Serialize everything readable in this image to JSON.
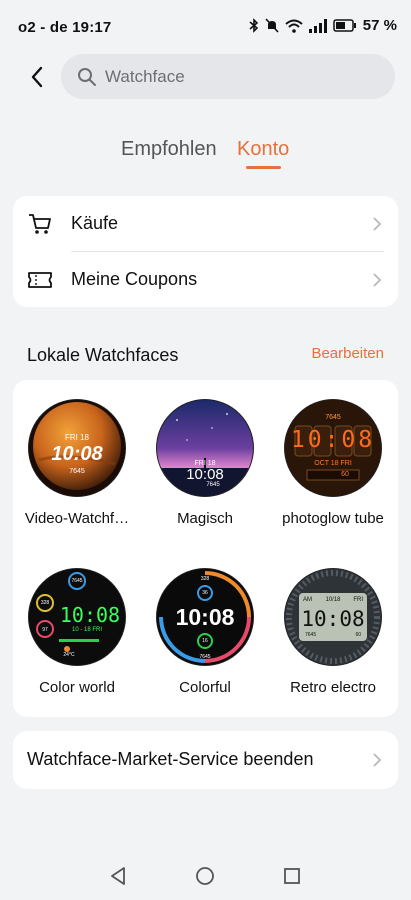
{
  "status_bar": {
    "carrier_time": "o2 - de 19:17",
    "battery": "57 %"
  },
  "search": {
    "placeholder": "Watchface"
  },
  "tabs": [
    {
      "label": "Empfohlen"
    },
    {
      "label": "Konto"
    }
  ],
  "account_menu": [
    {
      "label": "Käufe",
      "icon": "cart-icon"
    },
    {
      "label": "Meine Coupons",
      "icon": "coupon-icon"
    }
  ],
  "local_section": {
    "title": "Lokale Watchfaces",
    "action": "Bearbeiten"
  },
  "watchfaces": [
    {
      "name": "Video-Watchf…",
      "face": {
        "date": "FRI 18",
        "time": "10:08",
        "sub": "7645"
      }
    },
    {
      "name": "Magisch",
      "face": {
        "date": "FRI 18",
        "time": "10:08",
        "sub": "7645"
      }
    },
    {
      "name": "photoglow tube",
      "face": {
        "top": "7645",
        "time": "10:08",
        "date": "OCT 18 FRI",
        "sub": "60"
      }
    },
    {
      "name": "Color world",
      "face": {
        "time": "10:08",
        "date": "10 - 18 FRI",
        "c1": "7645",
        "c2": "328",
        "c3": "97",
        "temp": "24°C"
      }
    },
    {
      "name": "Colorful",
      "face": {
        "time": "10:08",
        "top": "328",
        "bottom": "7645",
        "c1": "36",
        "c2": "16"
      }
    },
    {
      "name": "Retro electro",
      "face": {
        "time": "10:08",
        "ampm": "AM",
        "date": "10/18",
        "day": "FRI",
        "steps": "7645",
        "bat": "60"
      }
    }
  ],
  "footer_item": {
    "label": "Watchface-Market-Service beenden"
  },
  "colors": {
    "accent": "#e8703a",
    "background": "#f1f3f5"
  }
}
